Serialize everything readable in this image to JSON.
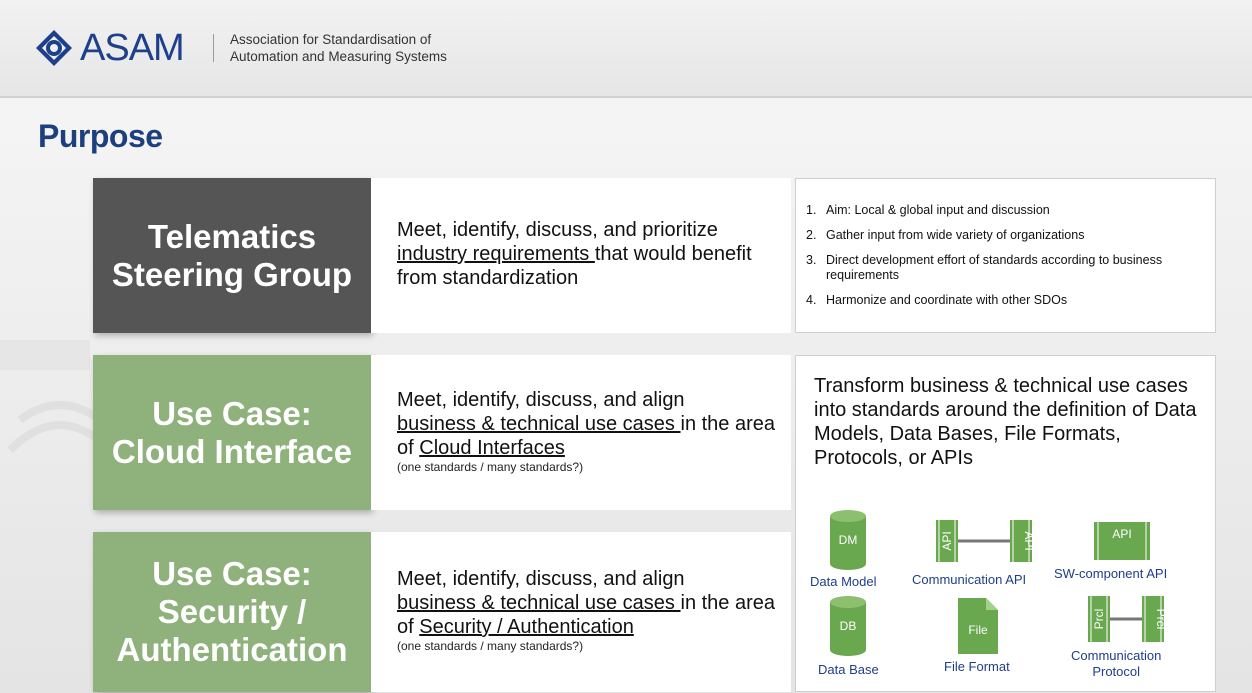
{
  "header": {
    "logo_text": "ASAM",
    "tagline_line1": "Association for Standardisation of",
    "tagline_line2": "Automation and Measuring Systems"
  },
  "page_title": "Purpose",
  "rows": {
    "r1": {
      "title_line1": "Telematics",
      "title_line2": "Steering Group",
      "desc_pre": "Meet, identify, discuss, and prioritize",
      "desc_link": "industry requirements ",
      "desc_post": "that would benefit from standardization"
    },
    "r2": {
      "title_line1": "Use Case:",
      "title_line2": "Cloud Interface",
      "desc_pre": "Meet, identify, discuss, and align",
      "desc_link": "business & technical use cases ",
      "desc_mid": "in the area of ",
      "desc_link2": "Cloud Interfaces",
      "desc_note": "(one standards / many standards?)"
    },
    "r3": {
      "title_line1": "Use Case:",
      "title_line2": "Security /",
      "title_line3": "Authentication",
      "desc_pre": "Meet, identify, discuss, and align",
      "desc_link": "business & technical use cases ",
      "desc_mid": "in the area of ",
      "desc_link2": "Security / Authentication",
      "desc_note": "(one standards / many standards?)"
    }
  },
  "aims": [
    {
      "num": "1.",
      "text": "Aim: Local & global input and discussion"
    },
    {
      "num": "2.",
      "text": "Gather input from wide variety of organizations"
    },
    {
      "num": "3.",
      "text": "Direct development effort of standards according to business requirements"
    },
    {
      "num": "4.",
      "text": "Harmonize and coordinate with other SDOs"
    }
  ],
  "transform_text": "Transform business & technical use cases into standards around the definition of Data Models, Data Bases, File Formats, Protocols, or APIs",
  "icons": {
    "data_model": {
      "glyph": "DM",
      "label": "Data Model"
    },
    "comm_api": {
      "glyph": "API",
      "label": "Communication API"
    },
    "sw_api": {
      "glyph": "API",
      "label": "SW-component API"
    },
    "data_base": {
      "glyph": "DB",
      "label": "Data Base"
    },
    "file_format": {
      "glyph": "File",
      "label": "File Format"
    },
    "comm_protocol": {
      "glyph": "Prcl",
      "label_line1": "Communication",
      "label_line2": "Protocol"
    }
  },
  "colors": {
    "brand_blue": "#1d3f8c",
    "dark_gray": "#555555",
    "green": "#8fb27d",
    "icon_green": "#6aa84f",
    "label_blue": "#1f3d8a"
  }
}
